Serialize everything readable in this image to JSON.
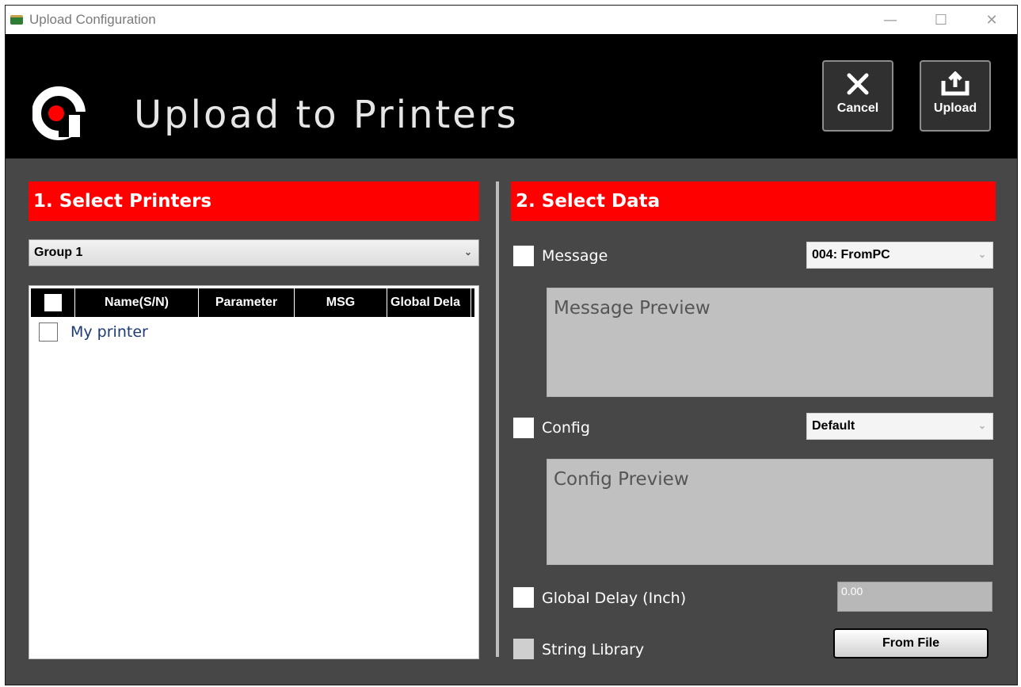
{
  "window": {
    "title": "Upload Configuration",
    "controls": {
      "minimize": "—",
      "maximize": "☐",
      "close": "✕"
    }
  },
  "header": {
    "title": "Upload to Printers",
    "cancel_label": "Cancel",
    "upload_label": "Upload"
  },
  "printers": {
    "section_title": "1. Select Printers",
    "group_selected": "Group 1",
    "columns": [
      "Name(S/N)",
      "Parameter",
      "MSG",
      "Global Dela"
    ],
    "rows": [
      {
        "name": "My printer",
        "checked": false
      }
    ]
  },
  "data": {
    "section_title": "2. Select Data",
    "message": {
      "label": "Message",
      "selected": "004: FromPC",
      "preview_placeholder": "Message Preview",
      "checked": false
    },
    "config": {
      "label": "Config",
      "selected": "Default",
      "preview_placeholder": "Config Preview",
      "checked": false
    },
    "global_delay": {
      "label": "Global Delay (Inch)",
      "value": "0.00",
      "checked": false
    },
    "string_library": {
      "label": "String Library",
      "button_label": "From File",
      "checked": false,
      "enabled": false
    }
  },
  "colors": {
    "accent": "#ff0000",
    "header_bg": "#000000",
    "panel_bg": "#474747",
    "logo_dot": "#ff0000"
  },
  "icons": {
    "app": "app-icon",
    "cancel": "x-icon",
    "upload": "upload-icon",
    "dropdown": "chevron-down-icon"
  }
}
